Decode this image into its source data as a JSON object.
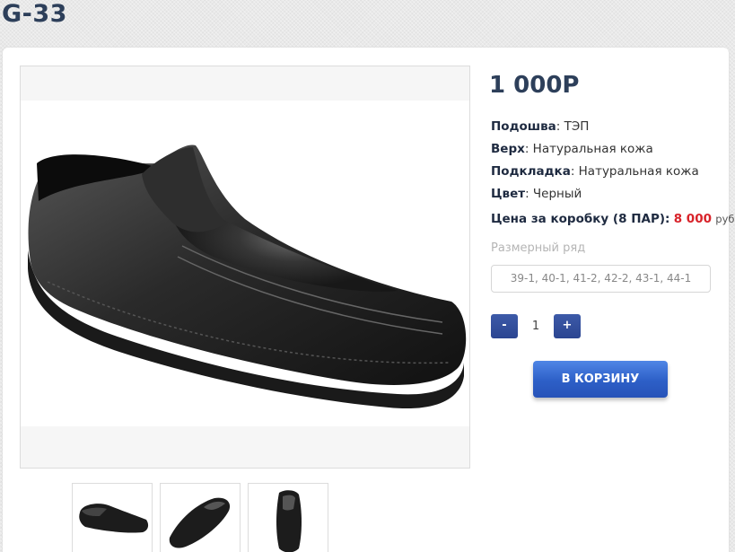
{
  "page": {
    "title": "G-33"
  },
  "product": {
    "price": "1 000Р",
    "attributes": [
      {
        "key": "Подошва",
        "value": "ТЭП"
      },
      {
        "key": "Верх",
        "value": "Натуральная кожа"
      },
      {
        "key": "Подкладка",
        "value": "Натуральная кожа"
      },
      {
        "key": "Цвет",
        "value": "Черный"
      }
    ],
    "box_price": {
      "label": "Цена за коробку (8 ПАР):",
      "value": "8 000",
      "unit": "руб"
    },
    "sizes": {
      "label": "Размерный ряд",
      "value": "39-1, 40-1, 41-2, 42-2, 43-1, 44-1"
    },
    "quantity": {
      "minus": "-",
      "value": "1",
      "plus": "+"
    },
    "cart_button": "В КОРЗИНУ"
  },
  "colors": {
    "accent": "#2b4591",
    "price_red": "#d8232a",
    "title": "#2d3f5a"
  }
}
